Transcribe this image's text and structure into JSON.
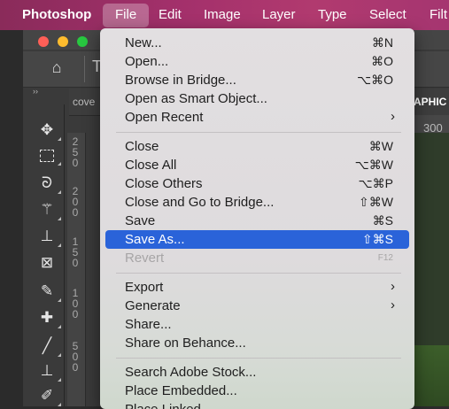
{
  "menubar": {
    "app_name": "Photoshop",
    "items": [
      "File",
      "Edit",
      "Image",
      "Layer",
      "Type",
      "Select",
      "Filt"
    ]
  },
  "document": {
    "tab_left": "cove",
    "tab_right": "APHIC",
    "ruler_value": "300",
    "ruler_numbers": [
      "2",
      "5",
      "0",
      "2",
      "0",
      "0",
      "1",
      "5",
      "0",
      "1",
      "0",
      "0",
      "5",
      "0",
      "0"
    ]
  },
  "file_menu": {
    "items": [
      {
        "label": "New...",
        "shortcut": "⌘N"
      },
      {
        "label": "Open...",
        "shortcut": "⌘O"
      },
      {
        "label": "Browse in Bridge...",
        "shortcut": "⌥⌘O"
      },
      {
        "label": "Open as Smart Object...",
        "shortcut": ""
      },
      {
        "label": "Open Recent",
        "shortcut": ""
      },
      {
        "label": "Close",
        "shortcut": "⌘W"
      },
      {
        "label": "Close All",
        "shortcut": "⌥⌘W"
      },
      {
        "label": "Close Others",
        "shortcut": "⌥⌘P"
      },
      {
        "label": "Close and Go to Bridge...",
        "shortcut": "⇧⌘W"
      },
      {
        "label": "Save",
        "shortcut": "⌘S"
      },
      {
        "label": "Save As...",
        "shortcut": "⇧⌘S"
      },
      {
        "label": "Revert",
        "shortcut": "F12"
      },
      {
        "label": "Export",
        "shortcut": ""
      },
      {
        "label": "Generate",
        "shortcut": ""
      },
      {
        "label": "Share...",
        "shortcut": ""
      },
      {
        "label": "Share on Behance...",
        "shortcut": ""
      },
      {
        "label": "Search Adobe Stock...",
        "shortcut": ""
      },
      {
        "label": "Place Embedded...",
        "shortcut": ""
      },
      {
        "label": "Place Linked...",
        "shortcut": ""
      }
    ],
    "submenu_arrow": "›"
  },
  "icons": {
    "home": "home-icon",
    "move": "move-icon",
    "marquee": "marquee-icon",
    "lasso": "lasso-icon",
    "magic_wand": "magic-wand-icon",
    "crop": "crop-icon",
    "frame": "frame-icon",
    "eyedropper": "eyedropper-icon",
    "healing": "healing-brush-icon",
    "brush": "brush-icon",
    "stamp": "clone-stamp-icon",
    "history_brush": "history-brush-icon"
  },
  "colors": {
    "selection": "#2a63d9",
    "menubar_gradient": "#a3306b",
    "close_light": "#ff5f57",
    "minimize_light": "#febc2e",
    "zoom_light": "#28c840"
  }
}
